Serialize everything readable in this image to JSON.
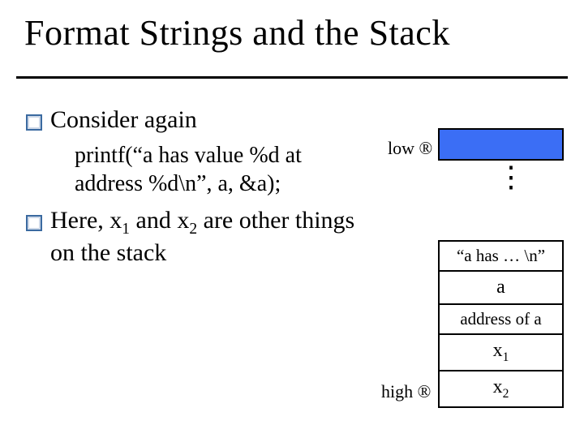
{
  "title": "Format Strings and the Stack",
  "bullets": {
    "b1": "Consider again",
    "code1": "printf(“a has value %d at address %d\\n”, a, &a);",
    "b2_pre": "Here, x",
    "b2_mid1": " and x",
    "b2_post": " are other things on the stack"
  },
  "subs": {
    "one": "1",
    "two": "2"
  },
  "diagram": {
    "low": "low ®",
    "high": "high ®",
    "vdots": "⋮",
    "cells": {
      "c0": "“a has … \\n”",
      "c1": "a",
      "c2": "address of a",
      "c3_pre": "x",
      "c4_pre": "x"
    }
  }
}
